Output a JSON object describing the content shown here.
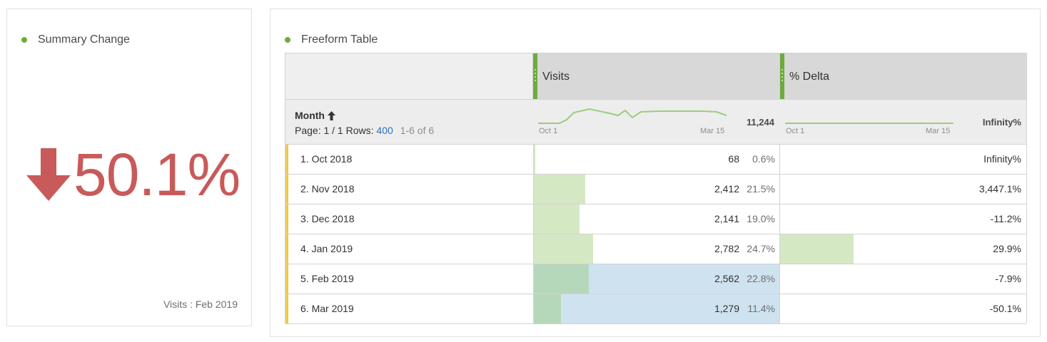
{
  "summary": {
    "title": "Summary Change",
    "value": "50.1%",
    "direction": "down",
    "footer": "Visits : Feb 2019",
    "color": "#c85a5a"
  },
  "freeform": {
    "title": "Freeform Table",
    "dimension": {
      "name": "Month",
      "page_label": "Page: 1 / 1",
      "rows_label": "Rows:",
      "rows_value": "400",
      "range": "1-6 of 6"
    },
    "columns": [
      {
        "label": "Visits",
        "total": "11,244",
        "spark_start": "Oct 1",
        "spark_end": "Mar 15"
      },
      {
        "label": "% Delta",
        "total": "Infinity%",
        "spark_start": "Oct 1",
        "spark_end": "Mar 15"
      }
    ],
    "rows": [
      {
        "label": "1.  Oct 2018",
        "visits": "68",
        "visits_pct": "0.6%",
        "visits_fraction": 0.006,
        "delta": "Infinity%",
        "delta_fraction": 0,
        "selected": false
      },
      {
        "label": "2.  Nov 2018",
        "visits": "2,412",
        "visits_pct": "21.5%",
        "visits_fraction": 0.215,
        "delta": "3,447.1%",
        "delta_fraction": 0,
        "selected": false
      },
      {
        "label": "3.  Dec 2018",
        "visits": "2,141",
        "visits_pct": "19.0%",
        "visits_fraction": 0.19,
        "delta": "-11.2%",
        "delta_fraction": 0,
        "selected": false
      },
      {
        "label": "4.  Jan 2019",
        "visits": "2,782",
        "visits_pct": "24.7%",
        "visits_fraction": 0.247,
        "delta": "29.9%",
        "delta_fraction": 0.299,
        "selected": false
      },
      {
        "label": "5.  Feb 2019",
        "visits": "2,562",
        "visits_pct": "22.8%",
        "visits_fraction": 0.228,
        "delta": "-7.9%",
        "delta_fraction": 0,
        "selected": true
      },
      {
        "label": "6.  Mar 2019",
        "visits": "1,279",
        "visits_pct": "11.4%",
        "visits_fraction": 0.114,
        "delta": "-50.1%",
        "delta_fraction": 0,
        "selected": true
      }
    ],
    "colors": {
      "accent_green": "#6cab3c",
      "bar_green": "#d5e8c4",
      "bar_green_selected": "#b5d8bb",
      "selected_bg": "#cfe2f0",
      "row_accent": "#f0c94b",
      "link_blue": "#2d6fc0"
    }
  }
}
